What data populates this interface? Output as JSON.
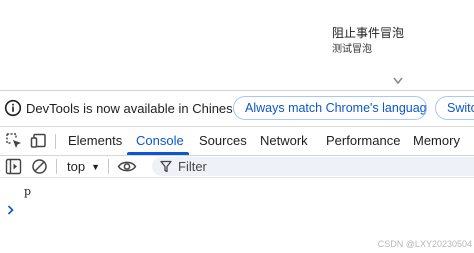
{
  "page_preview": {
    "button_label": "阻止事件冒泡",
    "text": "测试冒泡"
  },
  "infobar": {
    "message": "DevTools is now available in Chinese!",
    "button_match": "Always match Chrome's language",
    "button_switch": "Switch"
  },
  "tabs": {
    "items": [
      "Elements",
      "Console",
      "Sources",
      "Network",
      "Performance",
      "Memory"
    ],
    "active": "Console"
  },
  "console_toolbar": {
    "context": "top",
    "filter_placeholder": "Filter"
  },
  "console": {
    "log_entry": "p"
  },
  "watermark": "CSDN @LXY20230504",
  "colors": {
    "accent": "#0b57d0",
    "pill_border": "#a8c7fa",
    "filter_bg": "#eef2f8"
  }
}
